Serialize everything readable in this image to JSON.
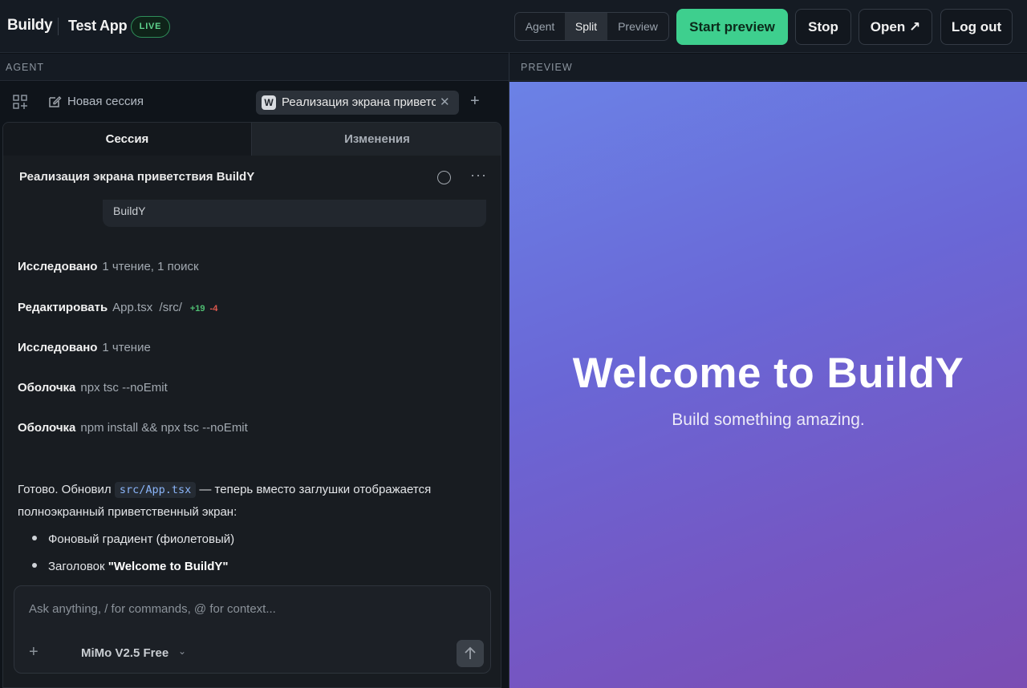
{
  "header": {
    "brand": "Buildy",
    "app_name": "Test App",
    "live_badge": "LIVE",
    "view_modes": [
      "Agent",
      "Split",
      "Preview"
    ],
    "active_view": "Split",
    "start_preview": "Start preview",
    "stop": "Stop",
    "open": "Open ↗",
    "log_out": "Log out",
    "accent_color": "#3ecf8e"
  },
  "panels": {
    "agent_label": "AGENT",
    "preview_label": "PREVIEW"
  },
  "agent": {
    "new_session": "Новая сессия",
    "session_tab_badge": "W",
    "session_tab_title": "Реализация экрана приветствия BuildY",
    "tabs": [
      "Сессия",
      "Изменения"
    ],
    "conversation_title": "Реализация экрана приветствия BuildY",
    "previous_message": "BuildY",
    "actions": [
      {
        "verb": "Исследовано",
        "detail": "1 чтение, 1 поиск"
      },
      {
        "verb": "Редактировать",
        "detail": "App.tsx  /src/",
        "added": "+19",
        "removed": "-4"
      },
      {
        "verb": "Исследовано",
        "detail": "1 чтение"
      },
      {
        "verb": "Оболочка",
        "detail": "npx tsc --noEmit"
      },
      {
        "verb": "Оболочка",
        "detail": "npm install && npx tsc --noEmit"
      }
    ],
    "summary": {
      "prefix": "Готово. Обновил ",
      "code": "src/App.tsx",
      "suffix": " — теперь вместо заглушки отображается полноэкранный приветственный экран:"
    },
    "bullets": [
      {
        "text": "Фоновый градиент (фиолетовый)",
        "bold": ""
      },
      {
        "text": "Заголовок ",
        "bold": "\"Welcome to BuildY\""
      }
    ],
    "composer": {
      "placeholder": "Ask anything, / for commands, @ for context...",
      "model": "MiMo V2.5 Free"
    }
  },
  "preview": {
    "title": "Welcome to BuildY",
    "subtitle": "Build something amazing.",
    "gradient_start": "#6b82e6",
    "gradient_end": "#7b4db3"
  }
}
